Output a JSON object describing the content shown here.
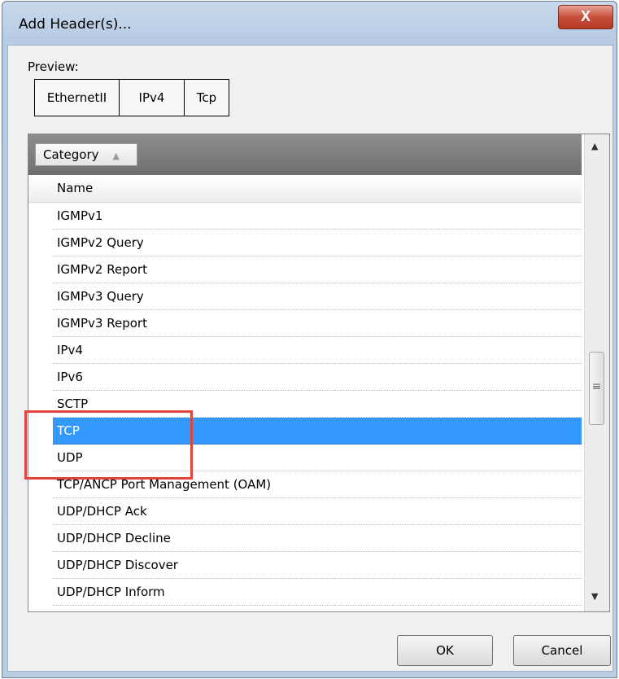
{
  "window": {
    "title": "Add Header(s)...",
    "close_label": "X"
  },
  "preview": {
    "label": "Preview:",
    "items": [
      "EthernetII",
      "IPv4",
      "Tcp"
    ]
  },
  "grid": {
    "group_by_label": "Category",
    "group_sort_glyph": "▲",
    "column_header": "Name",
    "rows": [
      "IGMPv1",
      "IGMPv2 Query",
      "IGMPv2 Report",
      "IGMPv3 Query",
      "IGMPv3 Report",
      "IPv4",
      "IPv6",
      "SCTP",
      "TCP",
      "UDP",
      "TCP/ANCP Port Management (OAM)",
      "UDP/DHCP Ack",
      "UDP/DHCP Decline",
      "UDP/DHCP Discover",
      "UDP/DHCP Inform"
    ],
    "selected_row": "TCP"
  },
  "buttons": {
    "ok": "OK",
    "cancel": "Cancel"
  },
  "colors": {
    "selection": "#3399ff",
    "highlight_box": "#e0453c",
    "close_button": "#c7503a"
  },
  "icons": [
    "close-icon",
    "sort-asc-icon",
    "scroll-up-icon",
    "scroll-down-icon",
    "scroll-grip-icon"
  ]
}
